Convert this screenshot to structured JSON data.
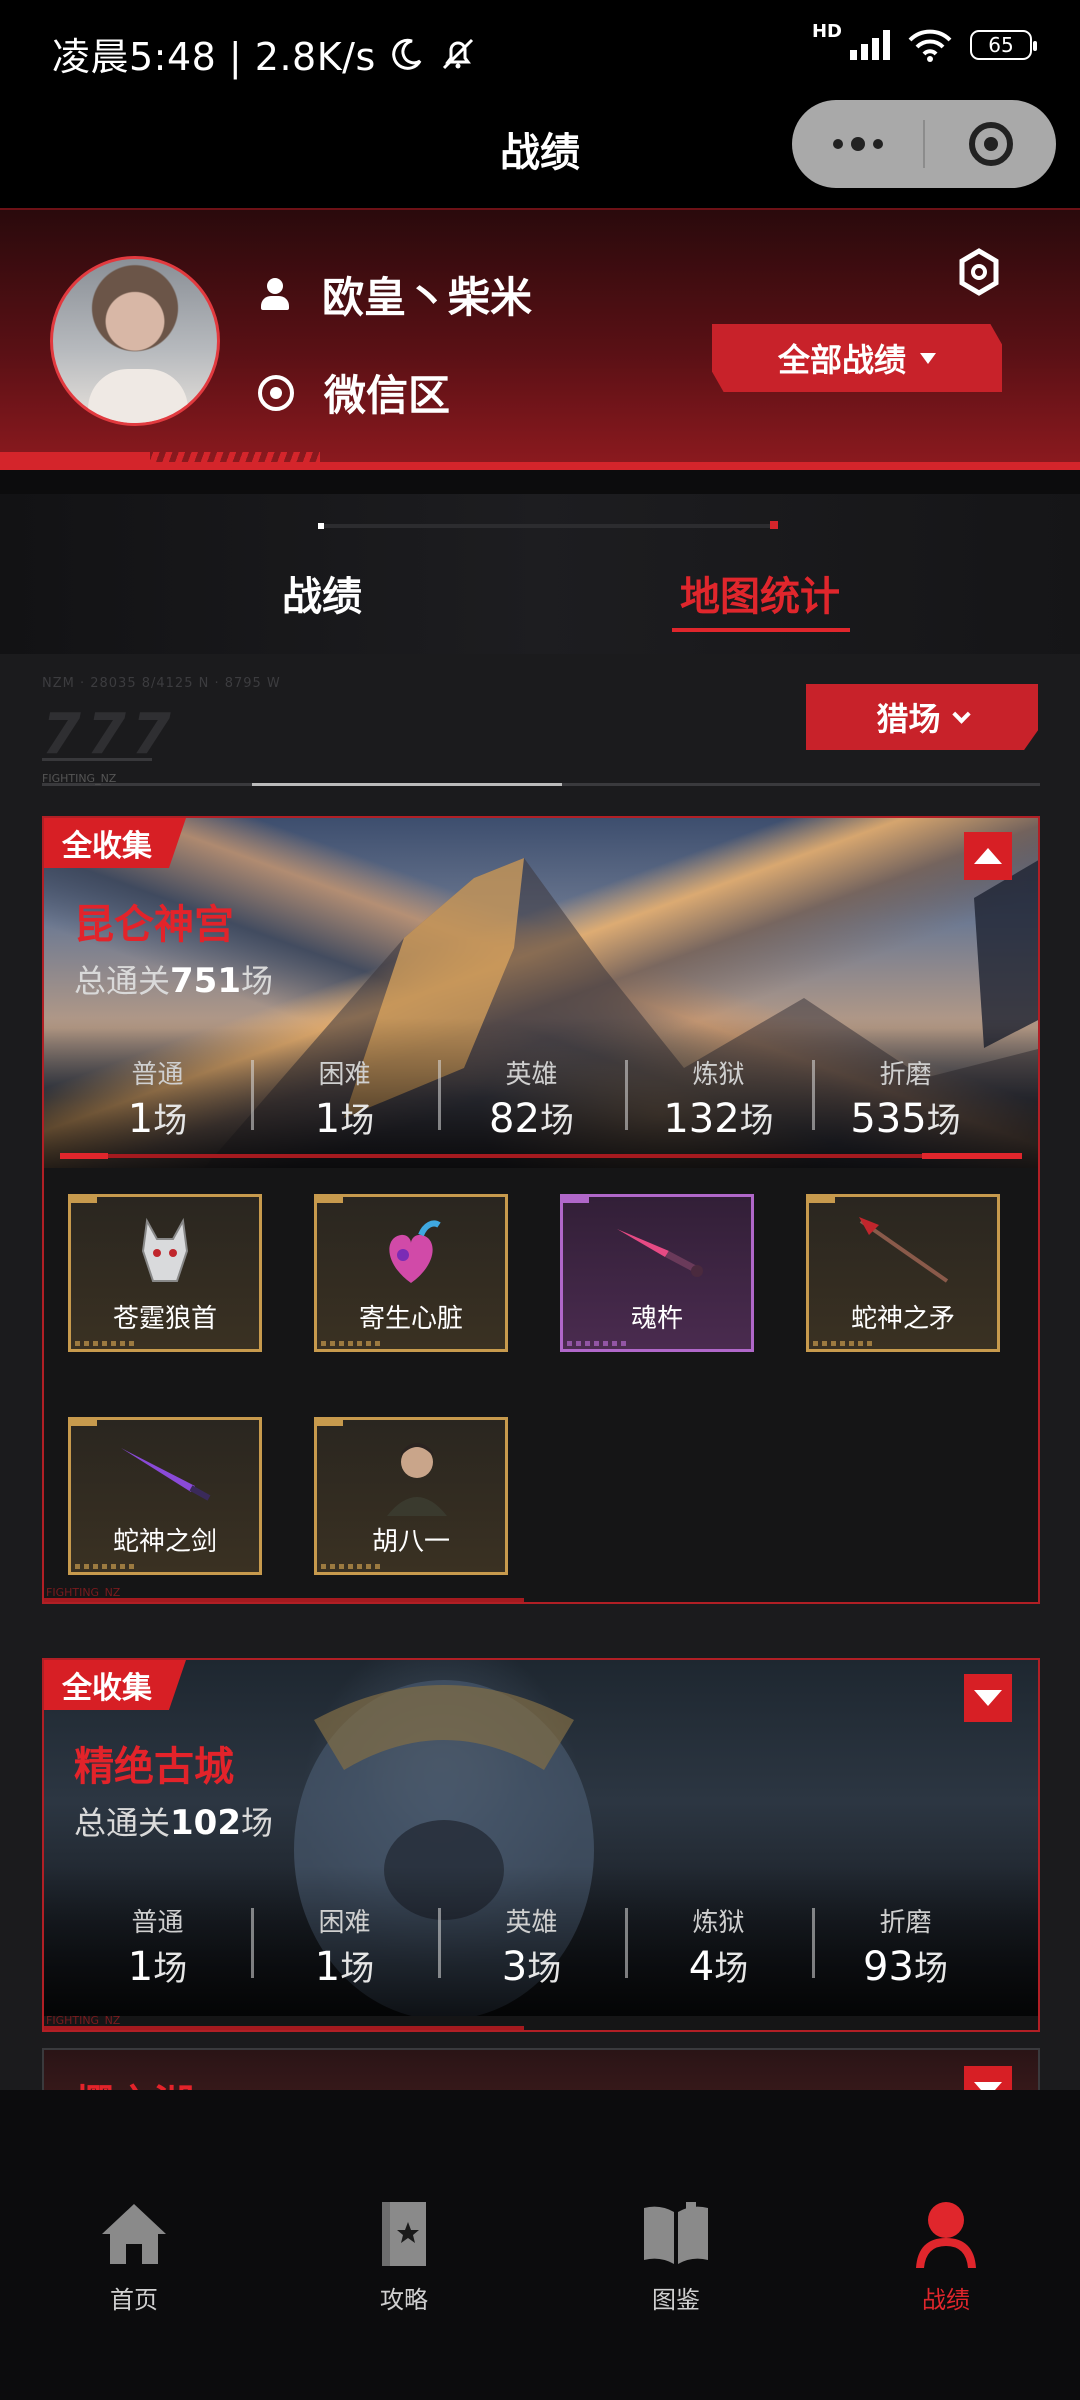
{
  "status_bar": {
    "time_speed": "凌晨5:48 | 2.8K/s",
    "hd": "HD",
    "battery": "65"
  },
  "titlebar": {
    "title": "战绩"
  },
  "profile": {
    "username": "欧皇丶柴米",
    "region": "微信区",
    "filter_button": "全部战绩"
  },
  "tabs": [
    {
      "label": "战绩",
      "active": false
    },
    {
      "label": "地图统计",
      "active": true
    }
  ],
  "filter": {
    "deco_text": "NZM · 28035 8/4125 N · 8795 W",
    "deco_num": "777",
    "deco_tag": "FIGHTING_NZ",
    "mode_button": "猎场"
  },
  "maps": [
    {
      "badge": "全收集",
      "name": "昆仑神宫",
      "total_prefix": "总通关",
      "total_value": "751",
      "unit": "场",
      "expanded": true,
      "difficulties": [
        {
          "name": "普通",
          "count": "1"
        },
        {
          "name": "困难",
          "count": "1"
        },
        {
          "name": "英雄",
          "count": "82"
        },
        {
          "name": "炼狱",
          "count": "132"
        },
        {
          "name": "折磨",
          "count": "535"
        }
      ],
      "items": [
        {
          "name": "苍霆狼首",
          "rarity": "gold"
        },
        {
          "name": "寄生心脏",
          "rarity": "gold"
        },
        {
          "name": "魂杵",
          "rarity": "purple"
        },
        {
          "name": "蛇神之矛",
          "rarity": "gold"
        },
        {
          "name": "蛇神之剑",
          "rarity": "gold"
        },
        {
          "name": "胡八一",
          "rarity": "gold"
        }
      ],
      "footer_tag": "FIGHTING_NZ"
    },
    {
      "badge": "全收集",
      "name": "精绝古城",
      "total_prefix": "总通关",
      "total_value": "102",
      "unit": "场",
      "expanded": false,
      "difficulties": [
        {
          "name": "普通",
          "count": "1"
        },
        {
          "name": "困难",
          "count": "1"
        },
        {
          "name": "英雄",
          "count": "3"
        },
        {
          "name": "炼狱",
          "count": "4"
        },
        {
          "name": "折磨",
          "count": "93"
        }
      ],
      "footer_tag": "FIGHTING_NZ"
    },
    {
      "name": "樱之湖",
      "expanded": false
    }
  ],
  "bottom_nav": [
    {
      "label": "首页",
      "icon": "home-icon",
      "active": false
    },
    {
      "label": "攻略",
      "icon": "guide-book-icon",
      "active": false
    },
    {
      "label": "图鉴",
      "icon": "open-book-icon",
      "active": false
    },
    {
      "label": "战绩",
      "icon": "user-icon",
      "active": true
    }
  ],
  "colors": {
    "accent_red": "#e0262c",
    "gold_rarity": "#c79a4d",
    "purple_rarity": "#b067c9",
    "background": "#1b1b1d"
  }
}
